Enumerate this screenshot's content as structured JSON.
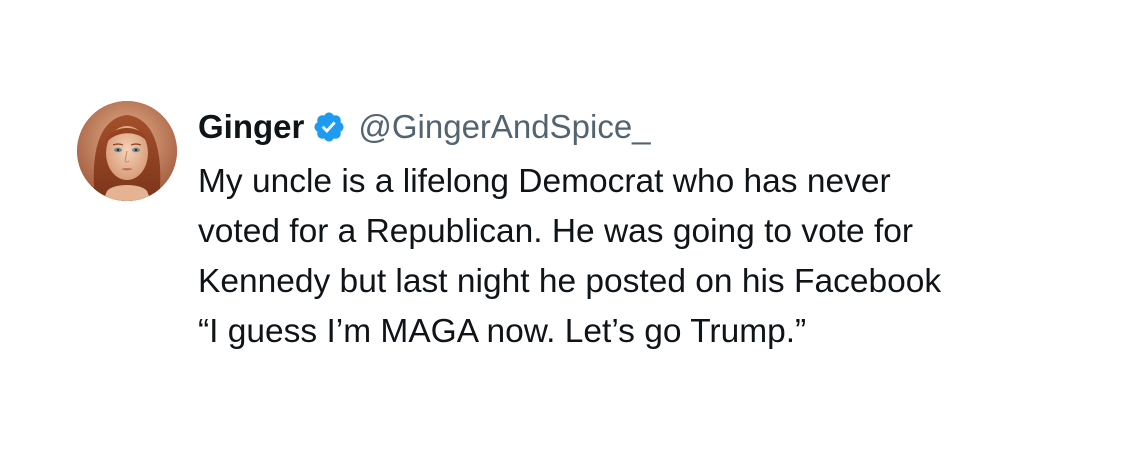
{
  "author": {
    "display_name": "Ginger",
    "handle": "@GingerAndSpice_",
    "verified": true,
    "verified_icon": "verified-badge-icon",
    "avatar": "profile-photo"
  },
  "tweet": {
    "lines": [
      "My uncle is a lifelong Democrat who has never",
      "voted for a Republican. He was going to vote for",
      "Kennedy but last night he posted on his Facebook",
      "“I guess I’m MAGA now. Let’s go Trump.”"
    ]
  },
  "colors": {
    "text_primary": "#0f1419",
    "text_secondary": "#536471",
    "verified_blue": "#1d9bf0",
    "background": "#ffffff"
  }
}
